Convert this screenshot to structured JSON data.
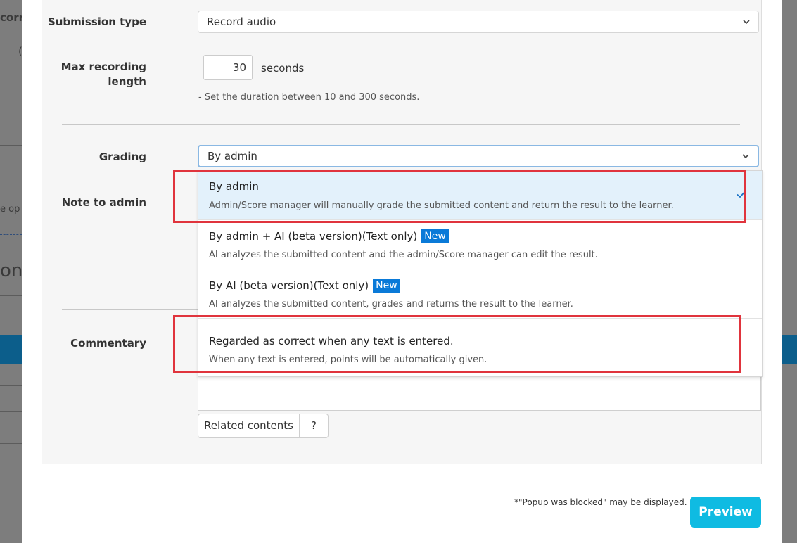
{
  "background": {
    "fragment_top": "corre",
    "fragment_paren": "(",
    "fragment_mid": "e op",
    "fragment_heading": "on"
  },
  "form": {
    "submission_type": {
      "label": "Submission type",
      "value": "Record audio"
    },
    "max_recording": {
      "label": "Max recording length",
      "value": "30",
      "unit": "seconds",
      "hint": "- Set the duration between 10 and 300 seconds."
    },
    "grading": {
      "label": "Grading",
      "value": "By admin"
    },
    "note_to_admin": {
      "label": "Note to admin"
    },
    "commentary": {
      "label": "Commentary"
    }
  },
  "grading_options": [
    {
      "title": "By admin",
      "desc": "Admin/Score manager will manually grade the submitted content and return the result to the learner.",
      "badge": "",
      "selected": true
    },
    {
      "title": "By admin + AI (beta version)(Text only)",
      "desc": "AI analyzes the submitted content and the admin/Score manager can edit the result.",
      "badge": "New",
      "selected": false
    },
    {
      "title": "By AI (beta version)(Text only)",
      "desc": "AI analyzes the submitted content, grades and returns the result to the learner.",
      "badge": "New",
      "selected": false
    },
    {
      "title": "Regarded as correct when any text is entered.",
      "desc": "When any text is entered, points will be automatically given.",
      "badge": "",
      "selected": false
    }
  ],
  "buttons": {
    "related_contents": "Related contents",
    "help": "?",
    "preview": "Preview"
  },
  "footer": {
    "popup_note": "*\"Popup was blocked\" may be displayed."
  },
  "colors": {
    "accent": "#0fbbe2",
    "badge": "#0a7ad8",
    "highlight": "#e0343d",
    "selected_bg": "#e3f1fb"
  }
}
